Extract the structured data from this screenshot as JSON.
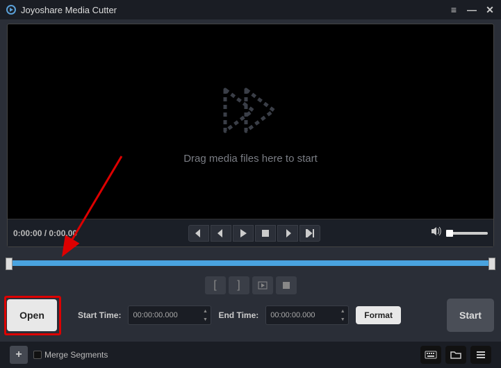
{
  "app": {
    "title": "Joyoshare Media Cutter"
  },
  "preview": {
    "drop_text": "Drag media files here to start",
    "time_display": "0:00:00 / 0:00.00"
  },
  "timeline": {
    "start_label": "Start Time:",
    "start_value": "00:00:00.000",
    "end_label": "End Time:",
    "end_value": "00:00:00.000"
  },
  "buttons": {
    "open": "Open",
    "format": "Format",
    "start": "Start"
  },
  "bottom": {
    "merge": "Merge Segments"
  }
}
